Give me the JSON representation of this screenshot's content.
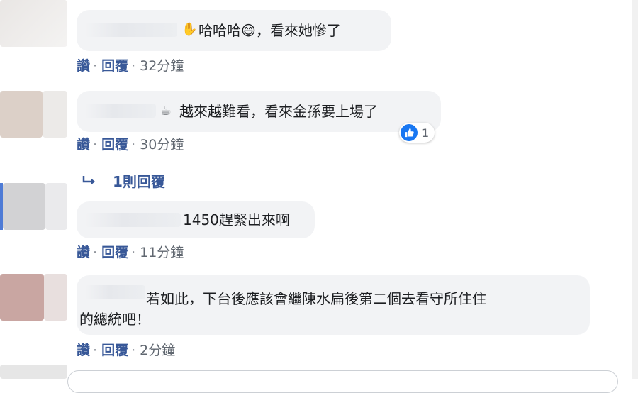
{
  "comments": [
    {
      "text": "哈哈哈😄，看來她慘了",
      "prefix_icon": "waving-hand-icon",
      "actions": {
        "like": "讚",
        "reply": "回覆",
        "time": "32分鐘"
      }
    },
    {
      "text": "越來越難看，看來金孫要上場了",
      "prefix_icon": "coffee-cup-icon",
      "reactions": {
        "count": "1"
      },
      "actions": {
        "like": "讚",
        "reply": "回覆",
        "time": "30分鐘"
      }
    },
    {
      "text": "1450趕緊出來啊",
      "actions": {
        "like": "讚",
        "reply": "回覆",
        "time": "11分鐘"
      }
    },
    {
      "text_line1": "若如此，下台後應該會繼陳水扁後第二個去看守所住住",
      "text_line2": "的總統吧！",
      "actions": {
        "like": "讚",
        "reply": "回覆",
        "time": "2分鐘"
      }
    }
  ],
  "reply_link": "1則回覆",
  "colors": {
    "bubble": "#f2f3f5",
    "link": "#385898",
    "like_blue": "#1877f2"
  }
}
